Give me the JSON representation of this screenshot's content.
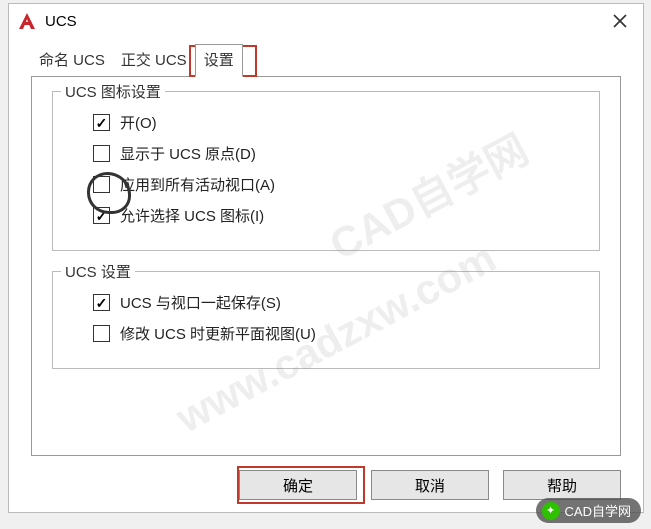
{
  "title": "UCS",
  "tabs": {
    "named": "命名 UCS",
    "ortho": "正交 UCS",
    "settings": "设置"
  },
  "group1": {
    "legend": "UCS 图标设置",
    "opt_on": "开(O)",
    "opt_origin": "显示于 UCS 原点(D)",
    "opt_apply": "应用到所有活动视口(A)",
    "opt_allow": "允许选择 UCS 图标(I)"
  },
  "group2": {
    "legend": "UCS 设置",
    "opt_save": "UCS 与视口一起保存(S)",
    "opt_update": "修改 UCS 时更新平面视图(U)"
  },
  "buttons": {
    "ok": "确定",
    "cancel": "取消",
    "help": "帮助"
  },
  "watermark": {
    "line1": "CAD自学网",
    "line2": "www.cadzxw.com",
    "pill": "CAD自学网"
  }
}
